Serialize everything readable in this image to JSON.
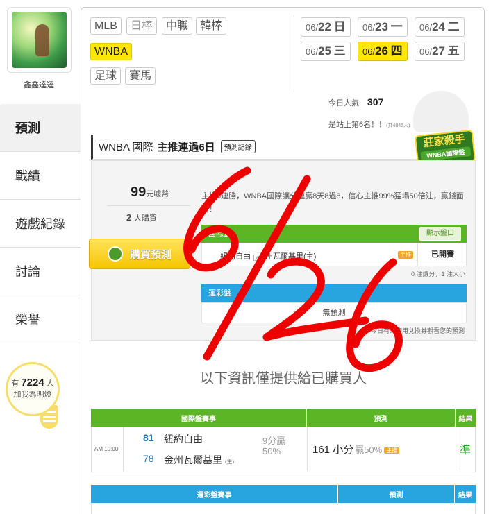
{
  "user": {
    "name": "鑫鑫達達"
  },
  "nav": [
    "預測",
    "戰績",
    "遊戲紀錄",
    "討論",
    "榮譽"
  ],
  "fans": {
    "prefix": "有",
    "count": "7224",
    "suffix": "人",
    "line2": "加我為明燈"
  },
  "sports": [
    {
      "label": "MLB",
      "state": "normal"
    },
    {
      "label": "日棒",
      "state": "disabled"
    },
    {
      "label": "中職",
      "state": "normal"
    },
    {
      "label": "韓棒",
      "state": "normal"
    },
    {
      "label": "WNBA",
      "state": "active"
    },
    {
      "label": "足球",
      "state": "normal"
    },
    {
      "label": "賽馬",
      "state": "normal"
    }
  ],
  "dates": [
    {
      "date": "06/",
      "day": "22",
      "weekday": "日",
      "active": false
    },
    {
      "date": "06/",
      "day": "23",
      "weekday": "一",
      "active": false
    },
    {
      "date": "06/",
      "day": "24",
      "weekday": "二",
      "active": false
    },
    {
      "date": "06/",
      "day": "25",
      "weekday": "三",
      "active": false
    },
    {
      "date": "06/",
      "day": "26",
      "weekday": "四",
      "active": true
    },
    {
      "date": "06/",
      "day": "27",
      "weekday": "五",
      "active": false
    }
  ],
  "popularity": {
    "label": "今日人氣",
    "value": "307"
  },
  "rank": {
    "text": "是站上第6名！！",
    "note": "(共4845人)"
  },
  "prediction": {
    "title": "WNBA 國際",
    "streak": "主推連過6日",
    "record_button": "預測記錄",
    "badge_title": "莊家殺手",
    "badge_sub": "WNBA國際盤",
    "price_value": "99",
    "price_unit": "元噱幣",
    "buyers_value": "2",
    "buyers_unit": "人購買",
    "buy_button": "購買預測",
    "description": "主推5連勝，WNBA國際讓分連贏8天8過8，信心主推99%猛塌50倍注，贏錢面對！",
    "intl_header": "國際盤",
    "show_button": "顯示盤口",
    "home_away": {
      "team1": "紐約自由",
      "vs": "vs",
      "team2": "州瓦爾基里(主)"
    },
    "pick_tag": "主推",
    "status": "已開賽",
    "note_intl": "0 注讓分，1 注大小",
    "sport_header": "運彩盤",
    "no_pred": "無預測",
    "note_sport": "今日有人使用兌換券觀看您的預測"
  },
  "notice": "以下資訊僅提供給已購買人",
  "results": {
    "headers": [
      "國際盤賽事",
      "預測",
      "結果"
    ],
    "row": {
      "time": "AM 10:00",
      "away_score": "81",
      "away_team": "紐約自由",
      "home_score": "78",
      "home_team": "金州瓦爾基里",
      "home_mark": "(主)",
      "margin1": "9分贏",
      "margin2": "50%",
      "pick": "161 小分",
      "pick_rate": "贏50%",
      "pick_tag": "主推",
      "result": "準"
    },
    "sport_headers": [
      "運彩盤賽事",
      "預測",
      "結果"
    ]
  },
  "overlay_text": "6/26",
  "colors": {
    "accent_yellow": "#ffe700",
    "green": "#5bb524",
    "blue": "#28a5df",
    "scribble_red": "#ee0000"
  }
}
